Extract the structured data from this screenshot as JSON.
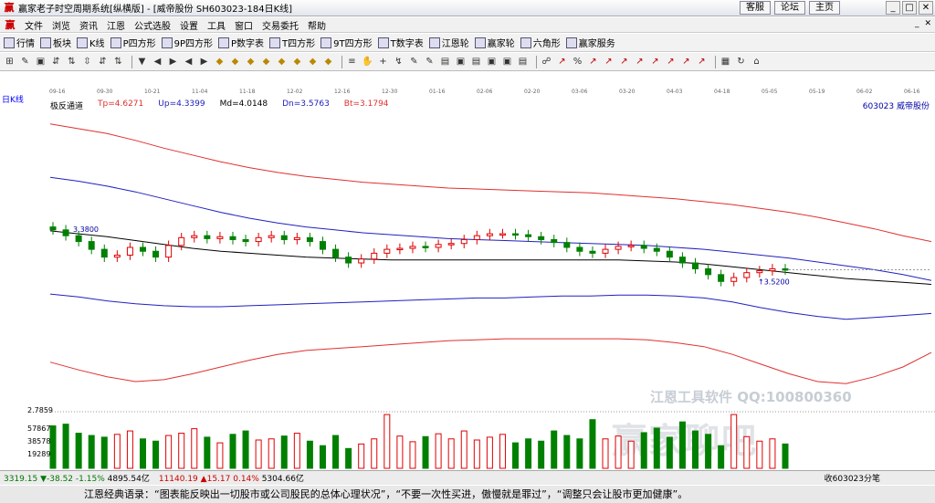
{
  "window": {
    "app_icon": "赢",
    "title": "赢家老子时空周期系统[纵横版] - [威帝股份  SH603023-184日K线]",
    "links": [
      "客服",
      "论坛",
      "主页"
    ],
    "controls": [
      "_",
      "□",
      "✕"
    ]
  },
  "menu": {
    "items": [
      "文件",
      "浏览",
      "资讯",
      "江恩",
      "公式选股",
      "设置",
      "工具",
      "窗口",
      "交易委托",
      "帮助"
    ],
    "right_controls": [
      "_",
      "✕"
    ]
  },
  "toolbar": {
    "buttons": [
      {
        "icon": "grid-icon",
        "label": "行情"
      },
      {
        "icon": "block-icon",
        "label": "板块"
      },
      {
        "icon": "kline-icon",
        "label": "K线"
      },
      {
        "icon": "p-icon",
        "label": "P四方形"
      },
      {
        "icon": "9p-icon",
        "label": "9P四方形"
      },
      {
        "icon": "p-icon",
        "label": "P数字表"
      },
      {
        "icon": "t-icon",
        "label": "T四方形"
      },
      {
        "icon": "9t-icon",
        "label": "9T四方形"
      },
      {
        "icon": "tn-icon",
        "label": "T数字表"
      },
      {
        "icon": "wheel-icon",
        "label": "江恩轮"
      },
      {
        "icon": "wheel-icon",
        "label": "赢家轮"
      },
      {
        "icon": "hexagon-icon",
        "label": "六角形"
      },
      {
        "icon": "dollar-icon",
        "label": "赢家服务"
      }
    ],
    "tools": [
      "⊞",
      "✎",
      "▣",
      "⇵",
      "⇅",
      "⇳",
      "⇵",
      "⇅",
      "▼",
      "◀",
      "▶",
      "◀",
      "▶",
      "◆",
      "◆",
      "◆",
      "◆",
      "◆",
      "◆",
      "◆",
      "◆",
      "≡",
      "✋",
      "+",
      "↯",
      "✎",
      "✎",
      "▤",
      "▣",
      "▤",
      "▣",
      "▣",
      "▤",
      "☍",
      "↗",
      "%",
      "↗",
      "↗",
      "↗",
      "↗",
      "↗",
      "↗",
      "↗",
      "↗",
      "▦",
      "↻",
      "⌂"
    ]
  },
  "dates": [
    "09-16",
    "09-30",
    "10-21",
    "11-04",
    "11-18",
    "12-02",
    "12-16",
    "12-30",
    "01-16",
    "02-06",
    "02-20",
    "03-06",
    "03-20",
    "04-03",
    "04-18",
    "05-05",
    "05-19",
    "06-02",
    "06-16"
  ],
  "indicator": {
    "period": "日K线",
    "name": "极反通道",
    "tp": "Tp=4.6271",
    "up": "Up=4.3399",
    "md": "Md=4.0148",
    "dn": "Dn=3.5763",
    "bt": "Bt=3.1794",
    "stock": "603023  威帝股份"
  },
  "annotations": {
    "high": "3.3800",
    "low": "3.5200",
    "axis_price": "2.7859"
  },
  "volume_axis": [
    "57867",
    "38578",
    "19289"
  ],
  "watermark": {
    "line1": "江恩工具软件  QQ:100800360",
    "line2": "赢家聊吧"
  },
  "status": {
    "sh_value": "3319.15",
    "sh_change": "▼-38.52",
    "sh_pct": "-1.15%",
    "sh_amount": "4895.54亿",
    "sz_value": "11140.19",
    "sz_change": "▲15.17",
    "sz_pct": "0.14%",
    "sz_amount": "5304.66亿",
    "right": "收603023分笔"
  },
  "quote": "江恩经典语录：“图表能反映出一切股市或公司股民的总体心理状况”，“不要一次性买进，傲慢就是罪过”，“调整只会让股市更加健康”。",
  "colors": {
    "red_band": "#e03030",
    "blue_band": "#2020c0",
    "mid_line": "#000000",
    "up_candle": "#e00000",
    "down_candle": "#008000"
  },
  "chart_data": {
    "type": "candlestick",
    "bands": {
      "tp": [
        5.95,
        5.9,
        5.85,
        5.78,
        5.7,
        5.63,
        5.56,
        5.5,
        5.45,
        5.41,
        5.38,
        5.35,
        5.33,
        5.31,
        5.29,
        5.28,
        5.27,
        5.26,
        5.25,
        5.24,
        5.22,
        5.2,
        5.18,
        5.15,
        5.12,
        5.08,
        5.04,
        4.99,
        4.93,
        4.87,
        4.8,
        4.74
      ],
      "up": [
        5.4,
        5.36,
        5.31,
        5.25,
        5.18,
        5.11,
        5.04,
        4.98,
        4.93,
        4.89,
        4.86,
        4.83,
        4.81,
        4.79,
        4.77,
        4.76,
        4.75,
        4.74,
        4.73,
        4.72,
        4.71,
        4.7,
        4.68,
        4.66,
        4.63,
        4.6,
        4.57,
        4.53,
        4.49,
        4.45,
        4.4,
        4.34
      ],
      "md": [
        4.85,
        4.82,
        4.79,
        4.75,
        4.71,
        4.67,
        4.64,
        4.62,
        4.6,
        4.58,
        4.57,
        4.56,
        4.55,
        4.55,
        4.55,
        4.55,
        4.55,
        4.55,
        4.55,
        4.55,
        4.55,
        4.54,
        4.53,
        4.51,
        4.48,
        4.45,
        4.42,
        4.39,
        4.36,
        4.34,
        4.32,
        4.3
      ],
      "dn": [
        4.2,
        4.17,
        4.13,
        4.1,
        4.08,
        4.07,
        4.07,
        4.08,
        4.09,
        4.1,
        4.11,
        4.12,
        4.13,
        4.14,
        4.15,
        4.16,
        4.16,
        4.17,
        4.18,
        4.18,
        4.19,
        4.19,
        4.18,
        4.16,
        4.12,
        4.06,
        4.01,
        3.97,
        3.94,
        3.96,
        3.98,
        4.0
      ],
      "bt": [
        3.5,
        3.42,
        3.35,
        3.3,
        3.32,
        3.38,
        3.45,
        3.52,
        3.58,
        3.62,
        3.64,
        3.66,
        3.68,
        3.7,
        3.72,
        3.73,
        3.74,
        3.74,
        3.74,
        3.74,
        3.74,
        3.73,
        3.7,
        3.66,
        3.58,
        3.48,
        3.38,
        3.3,
        3.28,
        3.35,
        3.45,
        3.6
      ]
    },
    "close": [
      4.86,
      4.8,
      4.74,
      4.66,
      4.58,
      4.6,
      4.68,
      4.64,
      4.58,
      4.7,
      4.78,
      4.8,
      4.77,
      4.79,
      4.76,
      4.74,
      4.78,
      4.8,
      4.76,
      4.78,
      4.74,
      4.66,
      4.58,
      4.52,
      4.56,
      4.62,
      4.66,
      4.67,
      4.69,
      4.68,
      4.71,
      4.72,
      4.76,
      4.8,
      4.82,
      4.82,
      4.81,
      4.79,
      4.76,
      4.73,
      4.68,
      4.64,
      4.62,
      4.66,
      4.69,
      4.7,
      4.67,
      4.64,
      4.58,
      4.52,
      4.46,
      4.4,
      4.33,
      4.37,
      4.42,
      4.44,
      4.46,
      4.45
    ],
    "volume": [
      0.75,
      0.78,
      0.62,
      0.58,
      0.55,
      0.6,
      0.66,
      0.52,
      0.48,
      0.58,
      0.62,
      0.7,
      0.55,
      0.45,
      0.6,
      0.66,
      0.5,
      0.52,
      0.57,
      0.62,
      0.48,
      0.4,
      0.58,
      0.35,
      0.43,
      0.52,
      0.95,
      0.57,
      0.47,
      0.56,
      0.61,
      0.52,
      0.66,
      0.5,
      0.55,
      0.6,
      0.45,
      0.52,
      0.48,
      0.66,
      0.58,
      0.52,
      0.86,
      0.52,
      0.57,
      0.48,
      0.63,
      0.71,
      0.55,
      0.82,
      0.66,
      0.6,
      0.4,
      0.95,
      0.56,
      0.48,
      0.52,
      0.43
    ]
  }
}
